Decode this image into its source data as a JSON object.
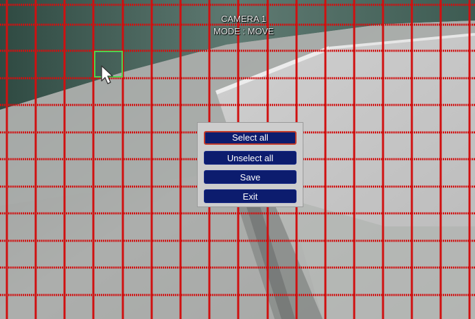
{
  "osd": {
    "camera": "CAMERA 1",
    "mode": "MODE : MOVE"
  },
  "menu": {
    "items": [
      {
        "label": "Select all",
        "selected": true
      },
      {
        "label": "Unselect all",
        "selected": false
      },
      {
        "label": "Save",
        "selected": false
      },
      {
        "label": "Exit",
        "selected": false
      }
    ]
  },
  "colors": {
    "grid_line": "#d01010",
    "active_cell": "#4fd34f",
    "button_bg": "#0c1c6e",
    "button_selected_border": "#c23a2a",
    "menu_bg": "#cdcdcd"
  },
  "icons": {
    "cursor": "mouse-pointer-icon"
  }
}
